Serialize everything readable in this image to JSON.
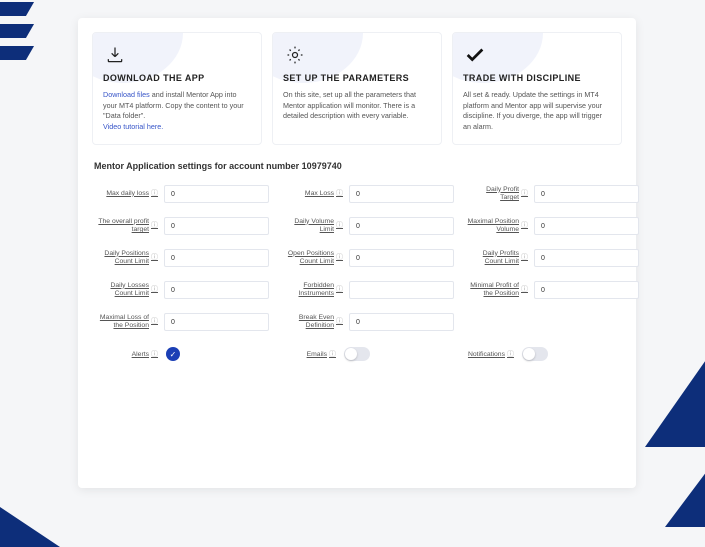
{
  "cards": [
    {
      "title": "DOWNLOAD THE APP",
      "linkA": "Download files",
      "textA": " and install Mentor App into your MT4 platform. Copy the content to your \"Data folder\".",
      "linkB": "Video tutorial here."
    },
    {
      "title": "SET UP THE PARAMETERS",
      "text": "On this site, set up all the parameters that Mentor application will monitor. There is a detailed description with every variable."
    },
    {
      "title": "TRADE WITH DISCIPLINE",
      "text": "All set & ready. Update the settings in MT4 platform and Mentor app will supervise your discipline. If you diverge, the app will trigger an alarm."
    }
  ],
  "settingsHeader": "Mentor Application settings for account number 10979740",
  "fields": {
    "maxDailyLoss": {
      "label": "Max daily loss",
      "value": "0"
    },
    "maxLoss": {
      "label": "Max Loss",
      "value": "0"
    },
    "dailyProfitTarget": {
      "label": "Daily Profit Target",
      "value": "0"
    },
    "overallProfitTarget": {
      "label": "The overall profit target",
      "value": "0"
    },
    "dailyVolumeLimit": {
      "label": "Daily Volume Limit",
      "value": "0"
    },
    "maxPositionVolume": {
      "label": "Maximal Position Volume",
      "value": "0"
    },
    "dailyPosCountLimit": {
      "label": "Daily Positions Count Limit",
      "value": "0"
    },
    "openPosCountLimit": {
      "label": "Open Positions Count Limit",
      "value": "0"
    },
    "dailyProfitsCount": {
      "label": "Daily Profits Count Limit",
      "value": "0"
    },
    "dailyLossesCount": {
      "label": "Daily Losses Count Limit",
      "value": "0"
    },
    "forbiddenInstr": {
      "label": "Forbidden Instruments",
      "value": ""
    },
    "minProfitPosition": {
      "label": "Minimal Profit of the Position",
      "value": "0"
    },
    "maxLossPosition": {
      "label": "Maximal Loss of the Position",
      "value": "0"
    },
    "breakEvenDef": {
      "label": "Break Even Definition",
      "value": "0"
    }
  },
  "toggles": {
    "alerts": {
      "label": "Alerts",
      "on": true
    },
    "emails": {
      "label": "Emails",
      "on": false
    },
    "notifications": {
      "label": "Notifications",
      "on": false
    }
  }
}
